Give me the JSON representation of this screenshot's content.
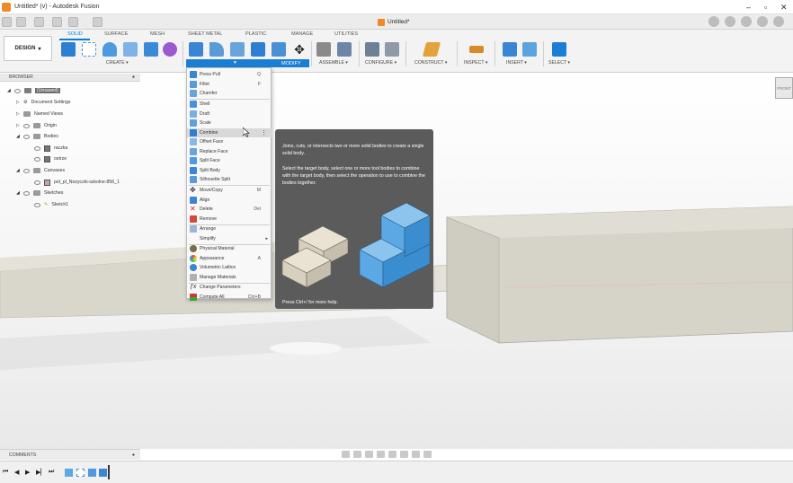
{
  "window": {
    "title": "Untitled* (v) - Autodesk Fusion",
    "doc_tab": "Untitled*"
  },
  "workspace": {
    "label": "DESIGN"
  },
  "tabs": [
    "SOLID",
    "SURFACE",
    "MESH",
    "SHEET METAL",
    "PLASTIC",
    "MANAGE",
    "UTILITIES"
  ],
  "groups": {
    "create": "CREATE",
    "modify": "MODIFY",
    "assemble": "ASSEMBLE",
    "configure": "CONFIGURE",
    "construct": "CONSTRUCT",
    "inspect": "INSPECT",
    "insert": "INSERT",
    "select": "SELECT"
  },
  "browser": {
    "header": "BROWSER",
    "items": [
      "(Unsaved)",
      "Document Settings",
      "Named Views",
      "Origin",
      "Bodies",
      "raczka",
      "ostrze",
      "Canvases",
      "pol_pl_Nozyczki-szkolne-856_1",
      "Sketches",
      "Sketch1"
    ]
  },
  "menu": {
    "items": [
      {
        "label": "Press Pull",
        "shortcut": "Q"
      },
      {
        "label": "Fillet",
        "shortcut": "F"
      },
      {
        "label": "Chamfer",
        "shortcut": ""
      },
      {
        "label": "Shell",
        "shortcut": ""
      },
      {
        "label": "Draft",
        "shortcut": ""
      },
      {
        "label": "Scale",
        "shortcut": ""
      },
      {
        "label": "Combine",
        "shortcut": ""
      },
      {
        "label": "Offset Face",
        "shortcut": ""
      },
      {
        "label": "Replace Face",
        "shortcut": ""
      },
      {
        "label": "Split Face",
        "shortcut": ""
      },
      {
        "label": "Split Body",
        "shortcut": ""
      },
      {
        "label": "Silhouette Split",
        "shortcut": ""
      },
      {
        "label": "Move/Copy",
        "shortcut": "M"
      },
      {
        "label": "Align",
        "shortcut": ""
      },
      {
        "label": "Delete",
        "shortcut": "Del"
      },
      {
        "label": "Remove",
        "shortcut": ""
      },
      {
        "label": "Arrange",
        "shortcut": ""
      },
      {
        "label": "Simplify",
        "shortcut": ""
      },
      {
        "label": "Physical Material",
        "shortcut": ""
      },
      {
        "label": "Appearance",
        "shortcut": "A"
      },
      {
        "label": "Volumetric Lattice",
        "shortcut": ""
      },
      {
        "label": "Manage Materials",
        "shortcut": ""
      },
      {
        "label": "Change Parameters",
        "shortcut": ""
      },
      {
        "label": "Compute All",
        "shortcut": "Ctrl+B"
      }
    ]
  },
  "tooltip": {
    "line1": "Joins, cuts, or intersects two or more solid bodies to create a single solid body.",
    "line2": "Select the target body, select one or more tool bodies to combine with the target body, then select the operation to use to combine the bodies together.",
    "help": "Press Ctrl+/ for more help."
  },
  "comments": {
    "label": "COMMENTS"
  },
  "viewcube": {
    "label": "FRONT"
  },
  "colors": {
    "accent": "#0a7cd6",
    "body": "#d9d7cc",
    "tooltip_bg": "#5b5b5b"
  }
}
